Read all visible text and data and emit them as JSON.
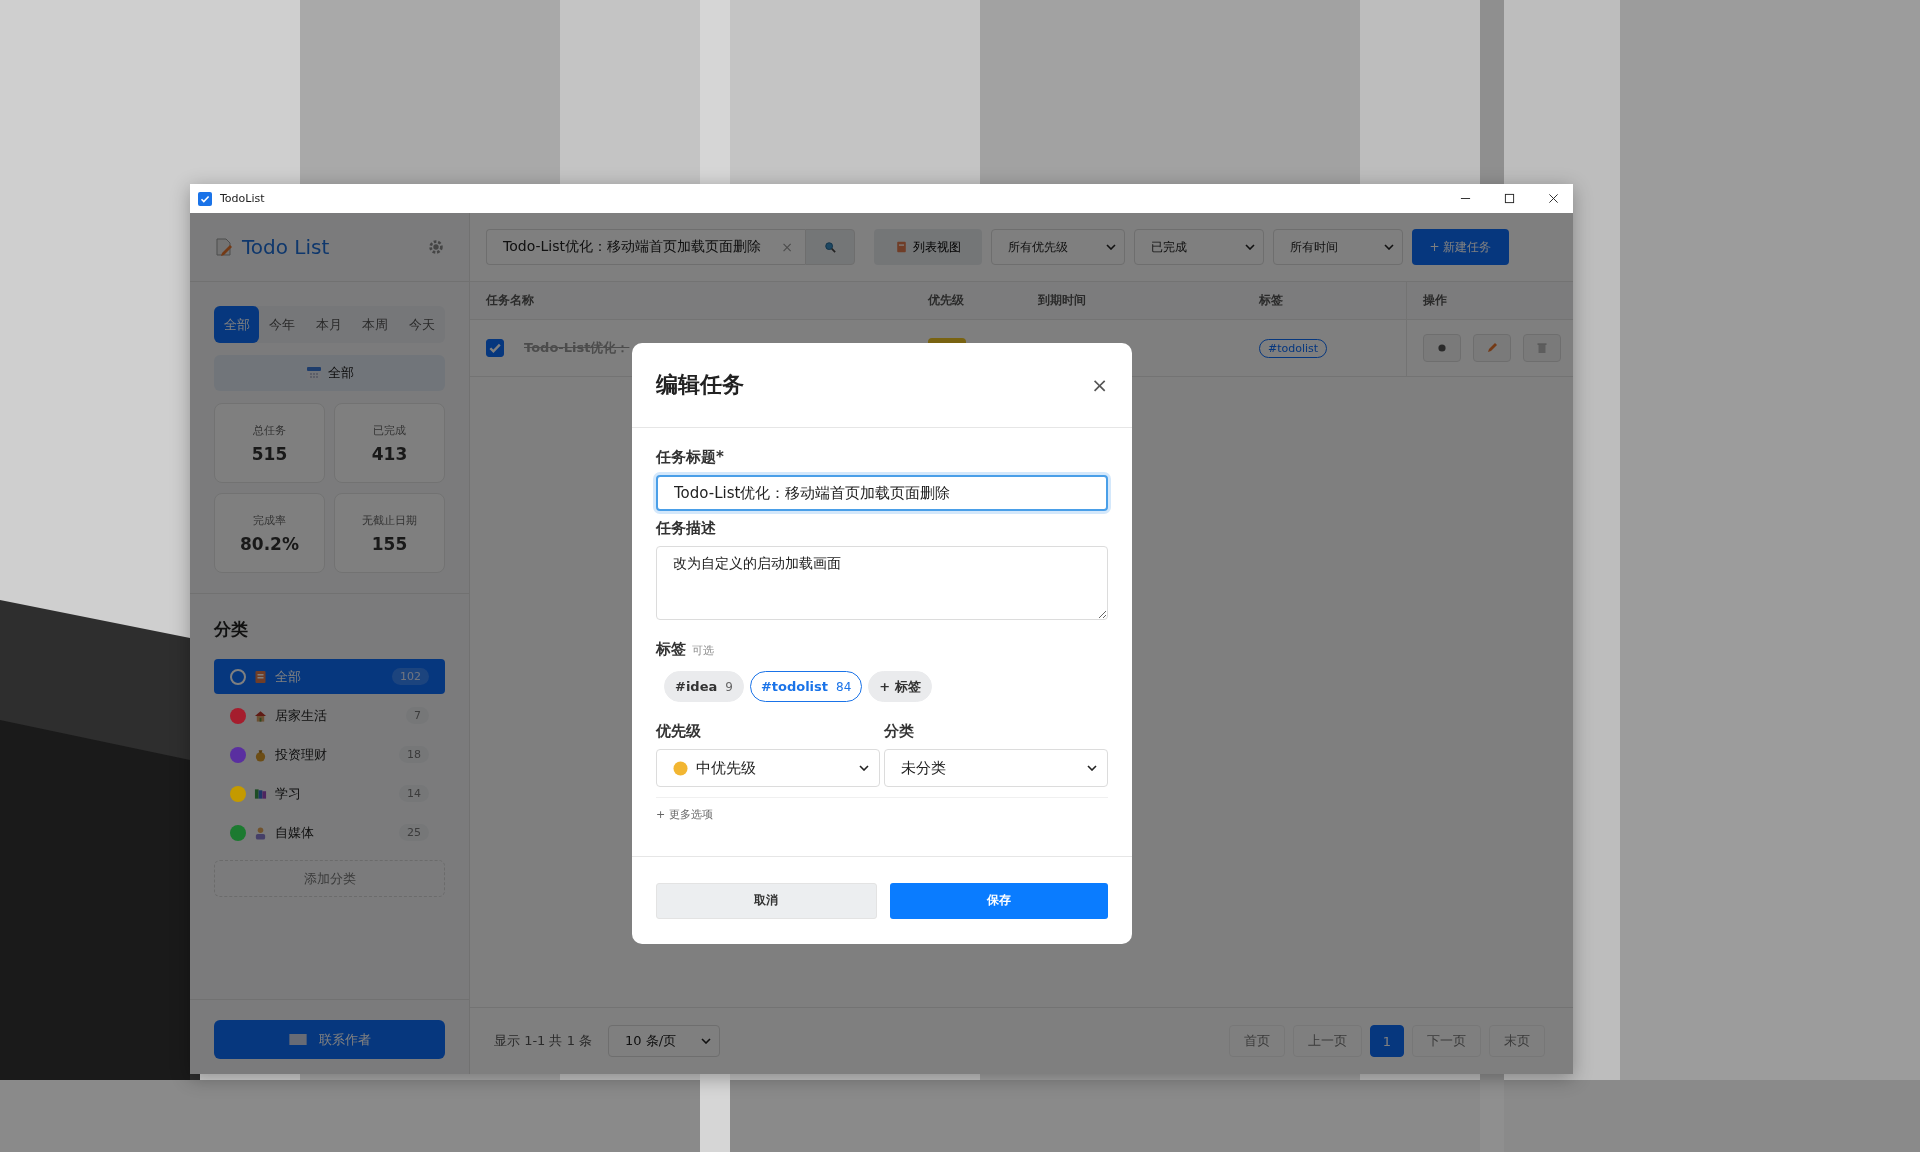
{
  "window": {
    "title": "TodoList"
  },
  "sidebar": {
    "app_name": "Todo List",
    "time_tabs": [
      {
        "label": "全部",
        "selected": true
      },
      {
        "label": "今年",
        "selected": false
      },
      {
        "label": "本月",
        "selected": false
      },
      {
        "label": "本周",
        "selected": false
      },
      {
        "label": "今天",
        "selected": false
      }
    ],
    "time_banner": "全部",
    "stats": [
      {
        "label": "总任务",
        "value": "515"
      },
      {
        "label": "已完成",
        "value": "413"
      },
      {
        "label": "完成率",
        "value": "80.2%"
      },
      {
        "label": "无截止日期",
        "value": "155"
      }
    ],
    "categories_title": "分类",
    "categories": [
      {
        "name": "全部",
        "count": "102",
        "selected": true
      },
      {
        "name": "居家生活",
        "count": "7",
        "color": "#a51d2d",
        "selected": false
      },
      {
        "name": "投资理财",
        "count": "18",
        "color": "#5a2fa0",
        "selected": false
      },
      {
        "name": "学习",
        "count": "14",
        "color": "#c49a00",
        "selected": false
      },
      {
        "name": "自媒体",
        "count": "25",
        "color": "#1c7a30",
        "selected": false
      }
    ],
    "add_category": "添加分类",
    "contact_button": "联系作者"
  },
  "toolbar": {
    "search_value": "Todo-List优化：移动端首页加载页面删除",
    "clear_symbol": "×",
    "view_button": "列表视图",
    "filters": [
      "所有优先级",
      "已完成",
      "所有时间"
    ],
    "new_task_button": "+ 新建任务"
  },
  "table": {
    "columns": [
      "任务名称",
      "优先级",
      "到期时间",
      "标签",
      "操作"
    ],
    "rows": [
      {
        "checked": true,
        "title": "Todo-List优化：",
        "tag": "#todolist"
      }
    ]
  },
  "footer": {
    "summary": "显示 1-1 共 1 条",
    "page_size": "10 条/页",
    "pages": [
      {
        "label": "首页",
        "selected": false
      },
      {
        "label": "上一页",
        "selected": false
      },
      {
        "label": "1",
        "selected": true
      },
      {
        "label": "下一页",
        "selected": false
      },
      {
        "label": "末页",
        "selected": false
      }
    ]
  },
  "dialog": {
    "title": "编辑任务",
    "close": "×",
    "title_label": "任务标题*",
    "title_value": "Todo-List优化：移动端首页加载页面删除",
    "description_label": "任务描述",
    "description_value": "改为自定义的启动加载画面",
    "tags_label": "标签",
    "tags_hint": "可选",
    "tags": [
      {
        "name": "#idea",
        "count": "9",
        "selected": false
      },
      {
        "name": "#todolist",
        "count": "84",
        "selected": true
      }
    ],
    "add_tag": "+ 标签",
    "priority_label": "优先级",
    "priority_value": "中优先级",
    "category_label": "分类",
    "category_value": "未分类",
    "more_options": "+ 更多选项",
    "cancel": "取消",
    "save": "保存"
  }
}
